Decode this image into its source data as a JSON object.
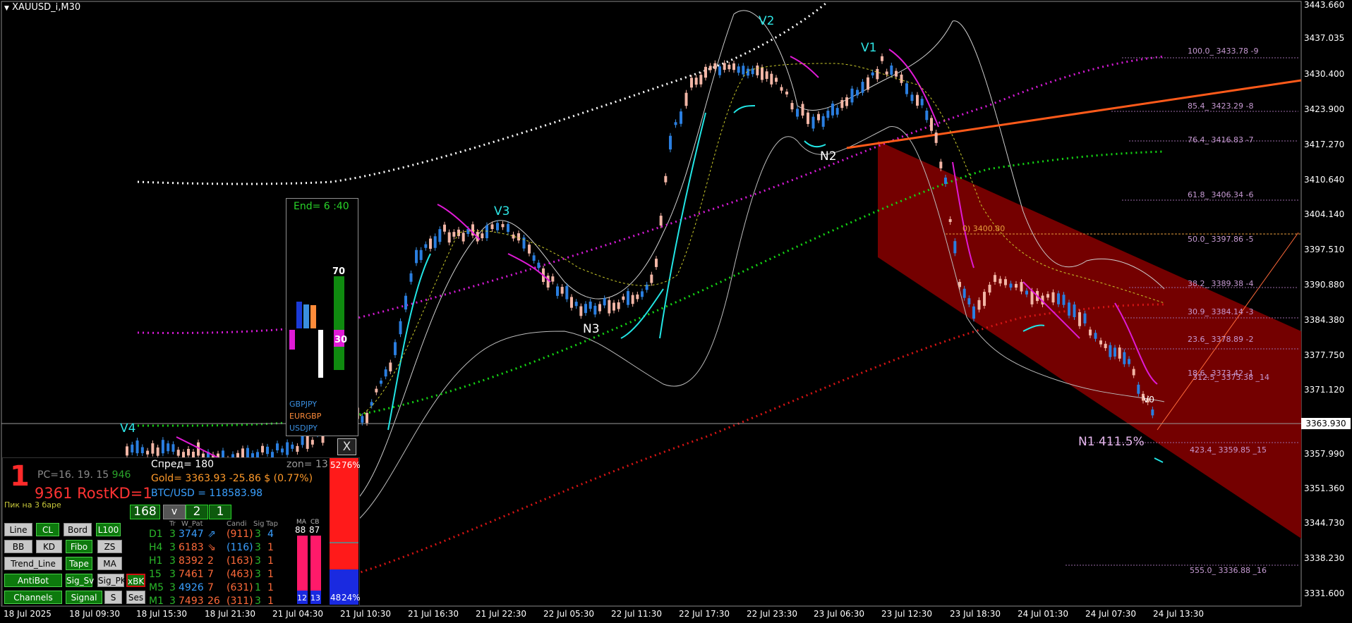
{
  "window": {
    "title": "XAUUSD_i,M30"
  },
  "price_axis": [
    "3443.660",
    "3437.035",
    "3430.400",
    "3423.900",
    "3417.270",
    "3410.640",
    "3404.140",
    "3397.510",
    "3390.880",
    "3384.380",
    "3377.750",
    "3371.120",
    "3357.990",
    "3351.360",
    "3344.730",
    "3338.230",
    "3331.600"
  ],
  "current_price": "3363.930",
  "time_axis": [
    "18 Jul 2025",
    "18 Jul 09:30",
    "18 Jul 15:30",
    "18 Jul 21:30",
    "21 Jul 04:30",
    "21 Jul 10:30",
    "21 Jul 16:30",
    "21 Jul 22:30",
    "22 Jul 05:30",
    "22 Jul 11:30",
    "22 Jul 17:30",
    "22 Jul 23:30",
    "23 Jul 06:30",
    "23 Jul 12:30",
    "23 Jul 18:30",
    "24 Jul 01:30",
    "24 Jul 07:30",
    "24 Jul 13:30"
  ],
  "fibo_levels": [
    {
      "text": "100.0_ 3433.78 -9"
    },
    {
      "text": "85.4_ 3423.29 -8"
    },
    {
      "text": "76.4_ 3416.83 -7"
    },
    {
      "text": "61.8_ 3406.34 -6"
    },
    {
      "text": "50.0_ 3397.86 -5"
    },
    {
      "text": "38.2_ 3389.38 -4"
    },
    {
      "text": "30.9_ 3384.14 -3"
    },
    {
      "text": "23.6_ 3378.89 -2"
    },
    {
      "text": "423.4_ 3359.85 _15"
    },
    {
      "text": "555.0_ 3336.88 _16"
    }
  ],
  "fibo_overlap": "18.6_ 3373.42 -1",
  "fibo_overlap2": "312.5_ 3373.38 _14",
  "level_3400": "0) 3400.80",
  "waves": {
    "v1": "V1",
    "v2": "V2",
    "v3": "V3",
    "v4": "V4",
    "v0": "V0",
    "n2": "N2",
    "n3": "N3"
  },
  "n1_label": "N1 411.5%",
  "correlation_panel": {
    "end": "End= 6 :40",
    "value_top": "70",
    "value_bottom": "30",
    "pairs": [
      {
        "name": "GBPJPY",
        "color": "#3a8fe0"
      },
      {
        "name": "EURGBP",
        "color": "#ff8c3a"
      },
      {
        "name": "USDJPY",
        "color": "#3a8fe0"
      }
    ],
    "close": "X"
  },
  "info_panel": {
    "big_number": "1",
    "pc": "PC=16. 19. 15",
    "pc_value": "946",
    "kd_value": "9361",
    "kd_label": "RostKD=1",
    "pik": "Пик на 3 баре",
    "spread": "Спред= 180",
    "zon": "zon= 13",
    "gold": "Gold= 3363.93 -25.86 $ (0.77%)",
    "btc": "BTC/USD = 118583.98",
    "tf": {
      "a": "168",
      "b": "v",
      "c": "2",
      "d": "1"
    },
    "buttons": [
      {
        "label": "Line",
        "style": "gray"
      },
      {
        "label": "CL",
        "style": "green"
      },
      {
        "label": "Bord",
        "style": "gray"
      },
      {
        "label": "L100",
        "style": "green"
      },
      {
        "label": "BB",
        "style": "gray"
      },
      {
        "label": "KD",
        "style": "gray"
      },
      {
        "label": "Fibo",
        "style": "green"
      },
      {
        "label": "ZS",
        "style": "gray"
      },
      {
        "label": "Trend_Line",
        "style": "gray"
      },
      {
        "label": "Tape",
        "style": "green"
      },
      {
        "label": "MA",
        "style": "gray"
      },
      {
        "label": "AntiBot",
        "style": "green"
      },
      {
        "label": "Sig_Sv",
        "style": "green"
      },
      {
        "label": "Sig_PK",
        "style": "gray"
      },
      {
        "label": "xBK",
        "style": "xbk"
      },
      {
        "label": "Channels",
        "style": "green"
      },
      {
        "label": "Signal",
        "style": "green"
      },
      {
        "label": "S",
        "style": "gray"
      },
      {
        "label": "Ses",
        "style": "gray"
      }
    ],
    "table_headers": {
      "tr": "Tr",
      "wpat": "W_Pat",
      "candi": "Candi",
      "sig": "Sig",
      "tap": "Tap",
      "ma": "MA",
      "cb": "CB"
    },
    "rows": [
      {
        "tf": "D1",
        "tr": "3",
        "val": "3747",
        "arrow": "⇗",
        "candi": "(911)",
        "sig": "3",
        "tap": "4",
        "vcol": "#3a9fff",
        "acol": "#3a9fff",
        "ccol": "#ff6a3a",
        "tcol": "#3a9fff"
      },
      {
        "tf": "H4",
        "tr": "3",
        "val": "6183",
        "arrow": "⇘",
        "candi": "(116)",
        "sig": "3",
        "tap": "1",
        "vcol": "#ff6a3a",
        "acol": "#ff6a3a",
        "ccol": "#3a9fff",
        "tcol": "#ff6a3a"
      },
      {
        "tf": "H1",
        "tr": "3",
        "val": "8392",
        "arrow": "2",
        "candi": "(163)",
        "sig": "3",
        "tap": "1",
        "vcol": "#ff6a3a",
        "acol": "#ff6a3a",
        "ccol": "#ff6a3a",
        "tcol": "#ff6a3a"
      },
      {
        "tf": "15",
        "tr": "3",
        "val": "7461",
        "arrow": "7",
        "candi": "(463)",
        "sig": "3",
        "tap": "1",
        "vcol": "#ff6a3a",
        "acol": "#ff6a3a",
        "ccol": "#ff6a3a",
        "tcol": "#ff6a3a"
      },
      {
        "tf": "M5",
        "tr": "3",
        "val": "4926",
        "arrow": "7",
        "candi": "(631)",
        "sig": "1",
        "tap": "1",
        "vcol": "#3a9fff",
        "acol": "#ff6a3a",
        "ccol": "#ff6a3a",
        "tcol": "#ff6a3a"
      },
      {
        "tf": "M1",
        "tr": "3",
        "val": "7493",
        "arrow": "26",
        "candi": "(311)",
        "sig": "3",
        "tap": "1",
        "vcol": "#ff6a3a",
        "acol": "#ff6a3a",
        "ccol": "#ff6a3a",
        "tcol": "#ff6a3a"
      }
    ],
    "ma_values": {
      "ma": "88",
      "cb": "87",
      "ma_b": "12",
      "cb_b": "13"
    },
    "bar_top": "52",
    "bar_pct_top": "76%",
    "bar_bottom": "48",
    "bar_pct_bottom": "24%"
  }
}
